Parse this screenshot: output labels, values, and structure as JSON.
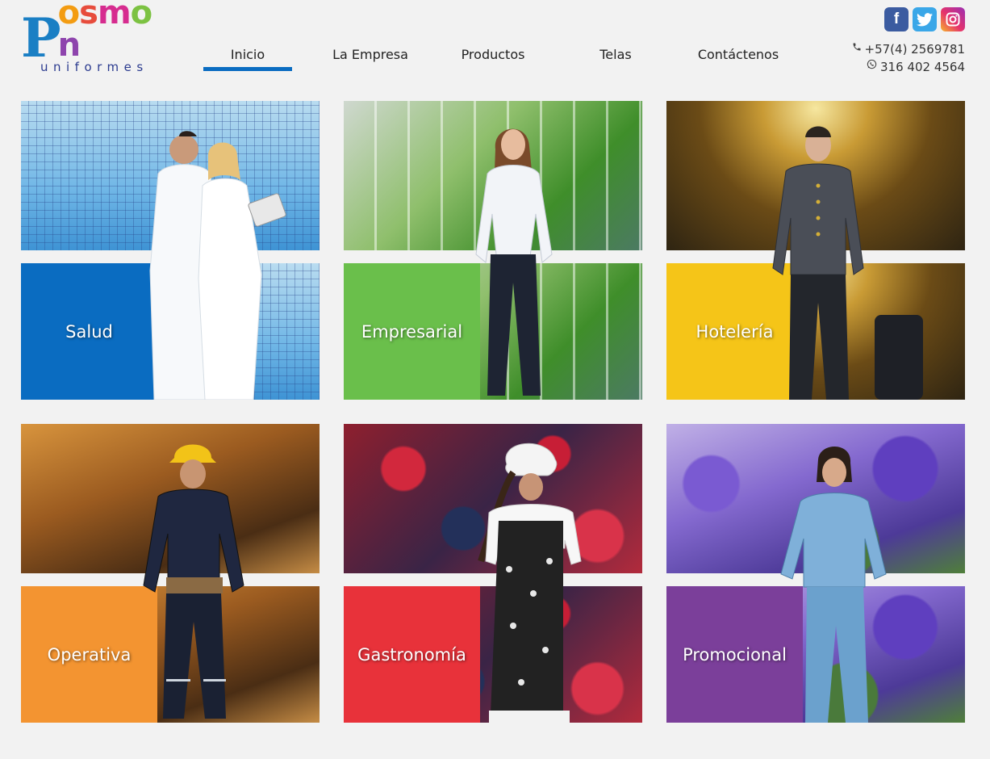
{
  "brand": {
    "logo_first": "P",
    "logo_rest": [
      "o",
      "s",
      "m",
      "o",
      "n"
    ],
    "logo_rest_colors": [
      "#f39c12",
      "#e74c3c",
      "#d62c8f",
      "#7cc242",
      "#8e44ad"
    ],
    "logo_sub": "uniformes"
  },
  "nav": {
    "items": [
      {
        "label": "Inicio",
        "active": true
      },
      {
        "label": "La Empresa",
        "active": false
      },
      {
        "label": "Productos",
        "active": false
      },
      {
        "label": "Telas",
        "active": false
      },
      {
        "label": "Contáctenos",
        "active": false
      }
    ],
    "active_color": "#0a6cc1"
  },
  "social": [
    {
      "name": "facebook-icon",
      "glyph": "f"
    },
    {
      "name": "twitter-icon",
      "glyph": "t"
    },
    {
      "name": "instagram-icon",
      "glyph": "ig"
    }
  ],
  "contact": {
    "phone_icon": "phone-icon",
    "phone": "+57(4) 2569781",
    "whatsapp_icon": "whatsapp-icon",
    "whatsapp": "316 402 4564"
  },
  "tiles": [
    {
      "label": "Salud",
      "color": "#0a6cc1",
      "photo": "bg-salud"
    },
    {
      "label": "Empresarial",
      "color": "#6abf4b",
      "photo": "bg-emp"
    },
    {
      "label": "Hotelería",
      "color": "#f5c518",
      "photo": "bg-hotel"
    },
    {
      "label": "Operativa",
      "color": "#f39431",
      "photo": "bg-oper"
    },
    {
      "label": "Gastronomía",
      "color": "#e8323a",
      "photo": "bg-gastro"
    },
    {
      "label": "Promocional",
      "color": "#7b3f9a",
      "photo": "bg-promo"
    }
  ]
}
